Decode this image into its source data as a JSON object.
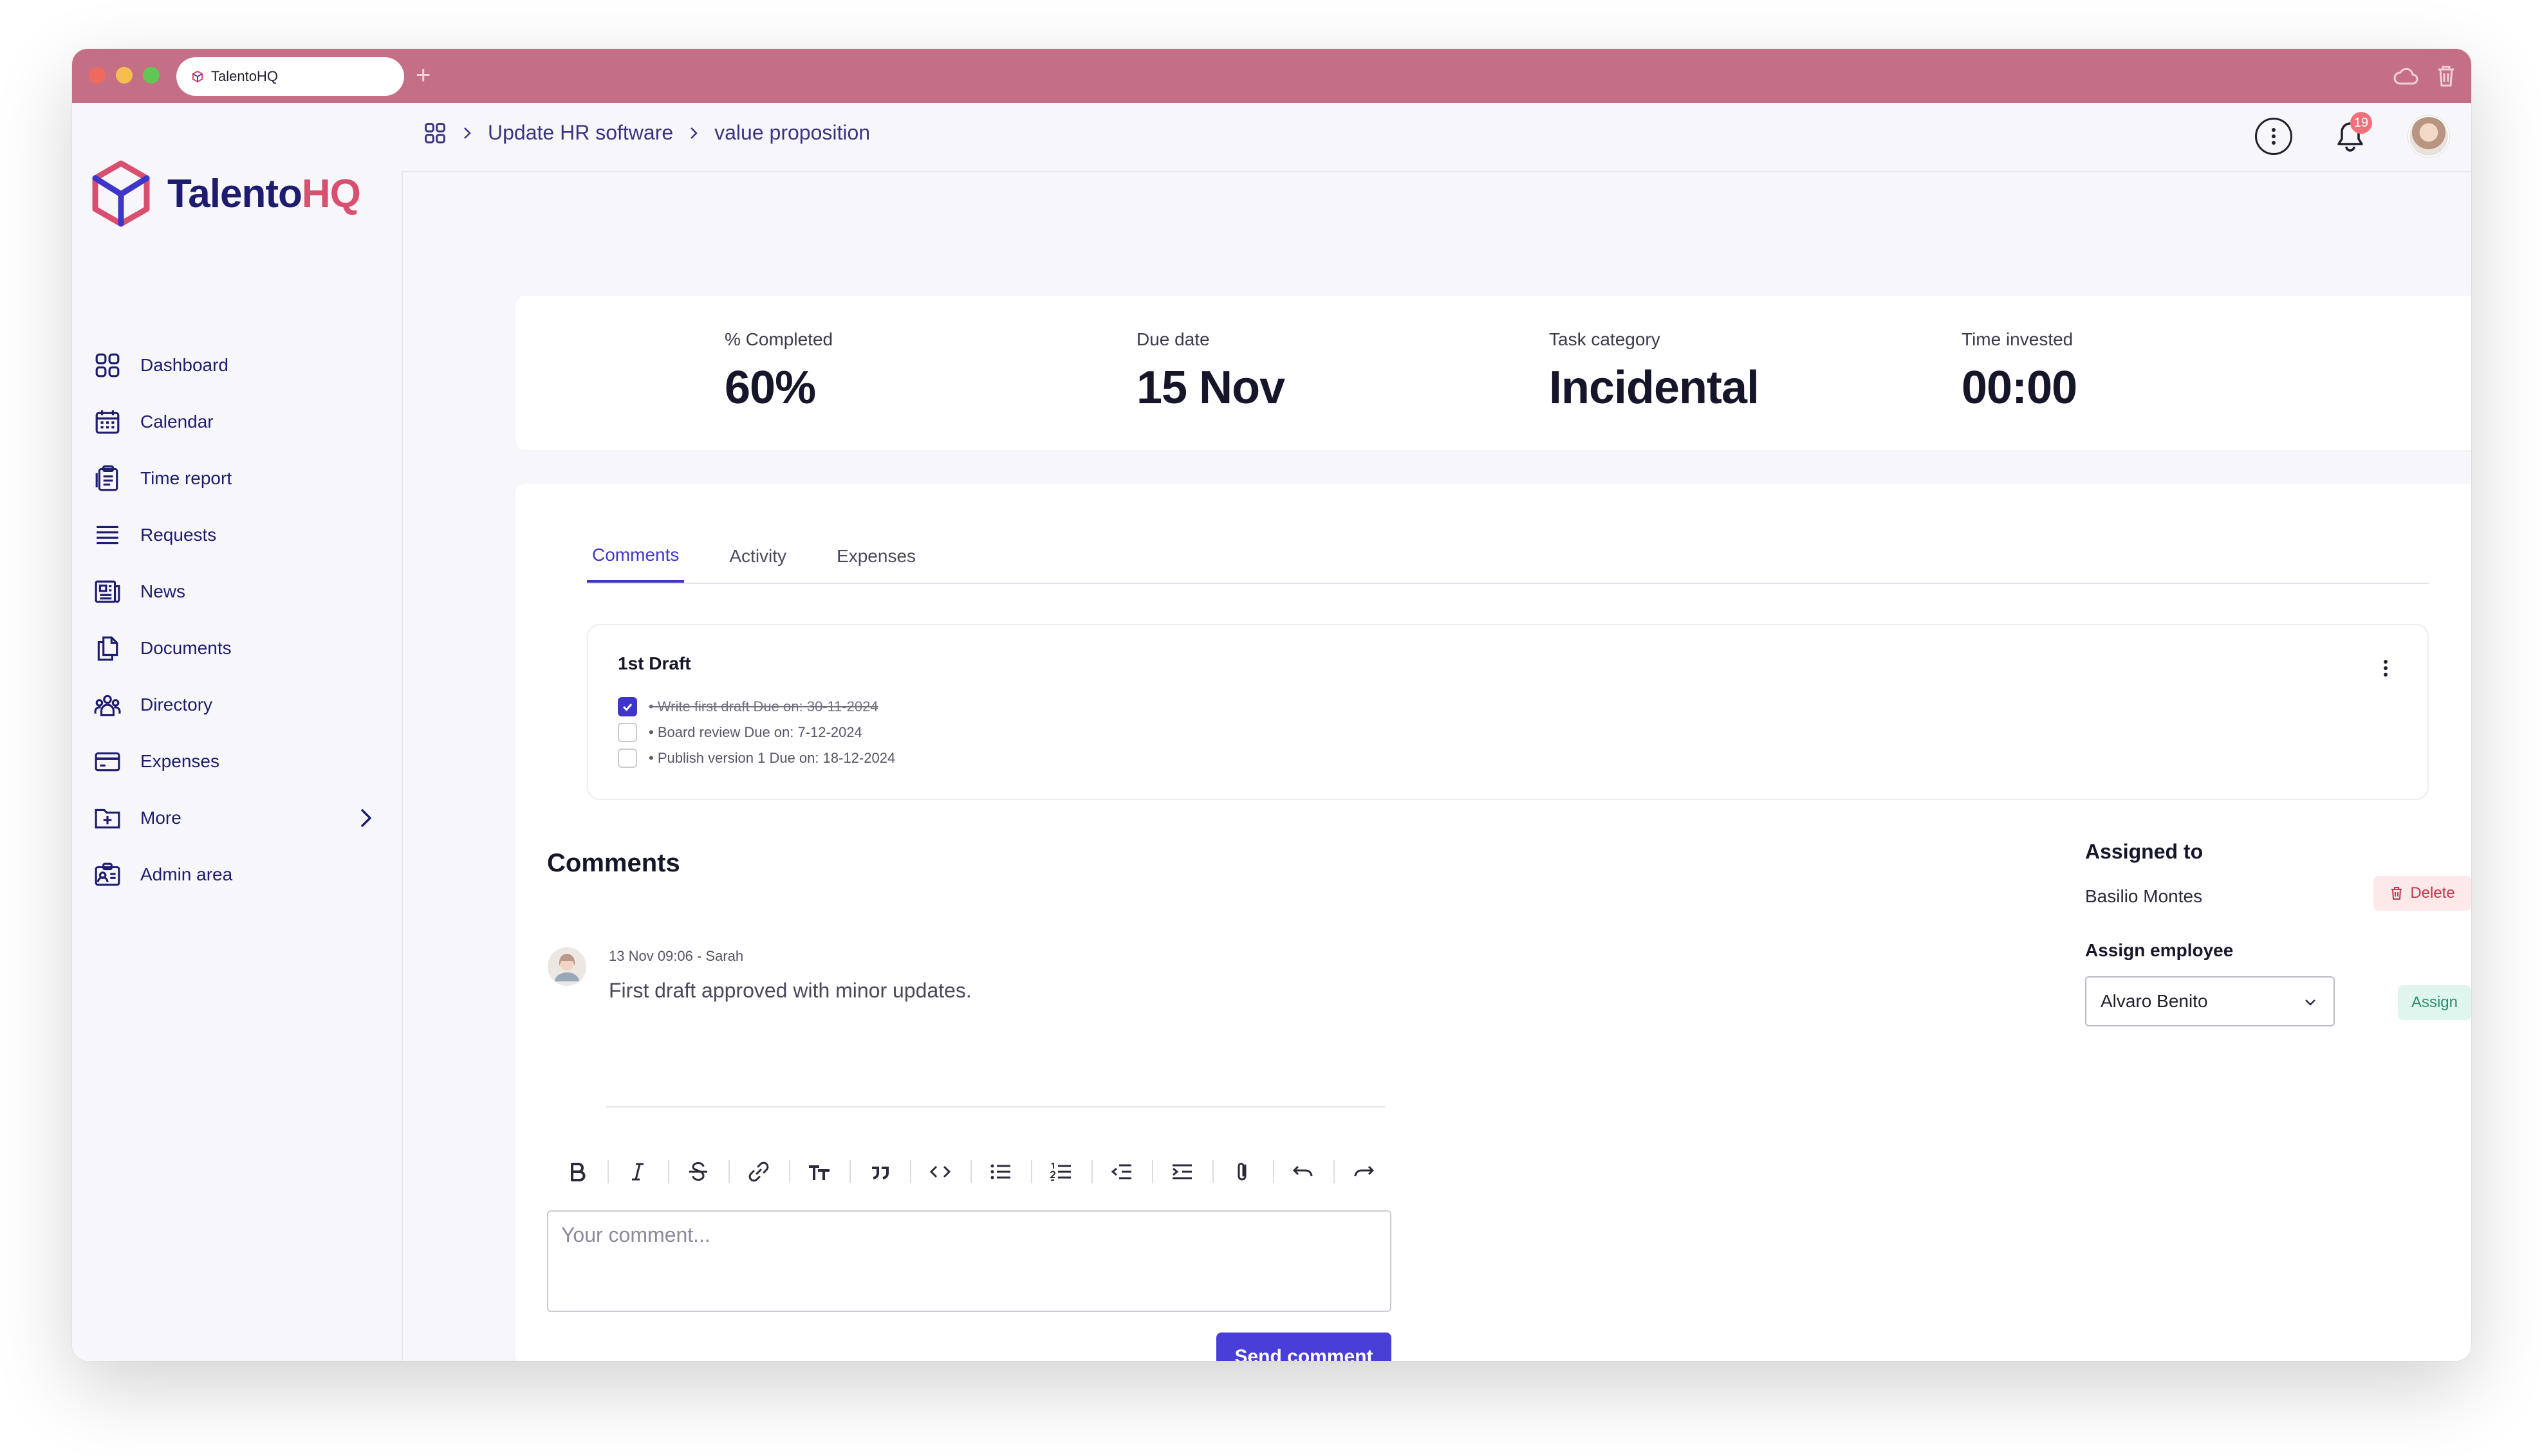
{
  "browser": {
    "tab_title": "TalentoHQ",
    "new_tab_label": "+",
    "colors": {
      "titlebar": "#c56f86",
      "close": "#ee6a5e",
      "minimize": "#f5be4f",
      "maximize": "#62c654"
    }
  },
  "app": {
    "logo_primary": "Talento",
    "logo_accent": "HQ",
    "accent_color": "#3f36c9"
  },
  "sidebar": {
    "items": [
      {
        "label": "Dashboard",
        "icon": "grid-icon"
      },
      {
        "label": "Calendar",
        "icon": "calendar-icon"
      },
      {
        "label": "Time report",
        "icon": "clipboard-icon"
      },
      {
        "label": "Requests",
        "icon": "list-icon"
      },
      {
        "label": "News",
        "icon": "newspaper-icon"
      },
      {
        "label": "Documents",
        "icon": "documents-icon"
      },
      {
        "label": "Directory",
        "icon": "people-icon"
      },
      {
        "label": "Expenses",
        "icon": "card-icon"
      },
      {
        "label": "More",
        "icon": "folder-plus-icon"
      },
      {
        "label": "Admin area",
        "icon": "id-card-icon"
      }
    ]
  },
  "breadcrumb": {
    "items": [
      "Update HR software",
      "value proposition"
    ]
  },
  "header": {
    "notification_count": "19"
  },
  "stats": [
    {
      "label": "% Completed",
      "value": "60%"
    },
    {
      "label": "Due date",
      "value": "15 Nov"
    },
    {
      "label": "Task category",
      "value": "Incidental"
    },
    {
      "label": "Time invested",
      "value": "00:00"
    }
  ],
  "tabs": [
    {
      "label": "Comments",
      "active": true
    },
    {
      "label": "Activity",
      "active": false
    },
    {
      "label": "Expenses",
      "active": false
    }
  ],
  "checklist": {
    "title": "1st Draft",
    "items": [
      {
        "text": "• Write first draft Due on: 30-11-2024",
        "checked": true
      },
      {
        "text": "• Board review Due on: 7-12-2024",
        "checked": false
      },
      {
        "text": "• Publish version 1 Due on: 18-12-2024",
        "checked": false
      }
    ]
  },
  "comments": {
    "title": "Comments",
    "items": [
      {
        "meta": "13 Nov 09:06 - Sarah",
        "text": "First draft approved with minor updates."
      }
    ],
    "editor_placeholder": "Your comment...",
    "send_label": "Send comment",
    "toolbar": [
      "bold-icon",
      "italic-icon",
      "strikethrough-icon",
      "link-icon",
      "text-size-icon",
      "quote-icon",
      "code-icon",
      "bullet-list-icon",
      "numbered-list-icon",
      "outdent-icon",
      "indent-icon",
      "attachment-icon",
      "undo-icon",
      "redo-icon"
    ]
  },
  "assignment": {
    "title": "Assigned to",
    "assignee": "Basilio Montes",
    "delete_label": "Delete",
    "assign_title": "Assign employee",
    "selected_employee": "Alvaro Benito",
    "assign_label": "Assign"
  }
}
